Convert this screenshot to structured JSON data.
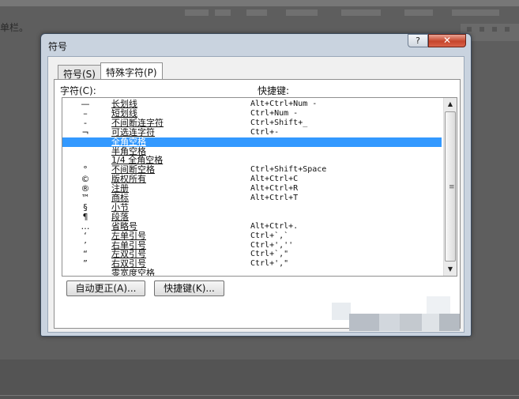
{
  "background": {
    "doc_text": "单栏。"
  },
  "dialog": {
    "title": "符号",
    "help_label": "?",
    "close_label": "✕"
  },
  "tabs": [
    {
      "label": "符号(S)"
    },
    {
      "label": "特殊字符(P)"
    }
  ],
  "labels": {
    "character": "字符(C):",
    "shortcut": "快捷键:"
  },
  "rows": [
    {
      "char": "—",
      "name": "长划线",
      "shortcut": "Alt+Ctrl+Num -"
    },
    {
      "char": "–",
      "name": "短划线",
      "shortcut": "Ctrl+Num -"
    },
    {
      "char": "‑",
      "name": "不间断连字符",
      "shortcut": "Ctrl+Shift+_"
    },
    {
      "char": "¬",
      "name": "可选连字符",
      "shortcut": "Ctrl+-"
    },
    {
      "char": "",
      "name": "全角空格",
      "shortcut": ""
    },
    {
      "char": "",
      "name": "半角空格",
      "shortcut": ""
    },
    {
      "char": "",
      "name": "1/4 全角空格",
      "shortcut": ""
    },
    {
      "char": "°",
      "name": "不间断空格",
      "shortcut": "Ctrl+Shift+Space"
    },
    {
      "char": "©",
      "name": "版权所有",
      "shortcut": "Alt+Ctrl+C"
    },
    {
      "char": "®",
      "name": "注册",
      "shortcut": "Alt+Ctrl+R"
    },
    {
      "char": "™",
      "name": "商标",
      "shortcut": "Alt+Ctrl+T"
    },
    {
      "char": "§",
      "name": "小节",
      "shortcut": ""
    },
    {
      "char": "¶",
      "name": "段落",
      "shortcut": ""
    },
    {
      "char": "…",
      "name": "省略号",
      "shortcut": "Alt+Ctrl+."
    },
    {
      "char": "‘",
      "name": "左单引号",
      "shortcut": "Ctrl+`,`"
    },
    {
      "char": "’",
      "name": "右单引号",
      "shortcut": "Ctrl+',''"
    },
    {
      "char": "“",
      "name": "左双引号",
      "shortcut": "Ctrl+`,\""
    },
    {
      "char": "”",
      "name": "右双引号",
      "shortcut": "Ctrl+',\""
    },
    {
      "char": "",
      "name": "零宽度空格",
      "shortcut": ""
    }
  ],
  "selected_row": "全角空格",
  "buttons": {
    "autocorrect": "自动更正(A)...",
    "shortcut_key": "快捷键(K)..."
  },
  "colors": {
    "selection": "#3399ff",
    "close": "#c6452c"
  }
}
